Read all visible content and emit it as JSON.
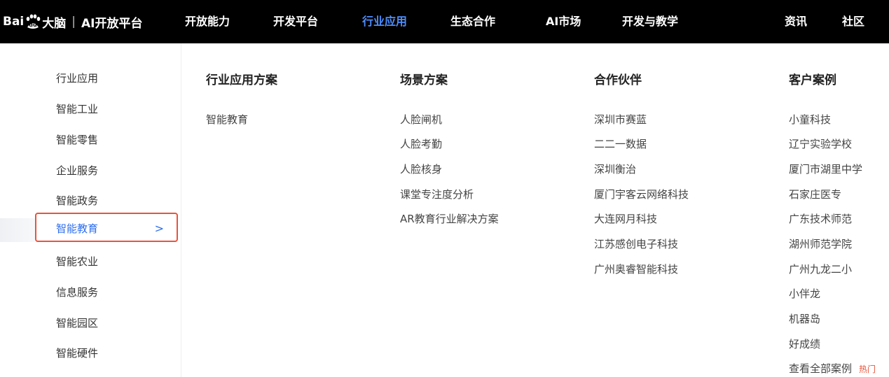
{
  "brand": {
    "logo_left": "Bai",
    "logo_paw": "du",
    "logo_cn": "大脑",
    "separator": "|",
    "platform": "AI开放平台"
  },
  "nav": {
    "items": [
      "开放能力",
      "开发平台",
      "行业应用",
      "生态合作",
      "AI市场",
      "开发与教学"
    ],
    "right_items": [
      "资讯",
      "社区"
    ],
    "active": "行业应用",
    "active_color": "#4c8dff"
  },
  "sidebar": {
    "items": [
      "行业应用",
      "智能工业",
      "智能零售",
      "企业服务",
      "智能政务",
      "智能教育",
      "智能农业",
      "信息服务",
      "智能园区",
      "智能硬件"
    ],
    "active": "智能教育",
    "chevron": ">",
    "highlight_border": "#e8543c"
  },
  "columns": {
    "solutions": {
      "title": "行业应用方案",
      "links": [
        "智能教育"
      ]
    },
    "scenarios": {
      "title": "场景方案",
      "links": [
        "人脸闸机",
        "人脸考勤",
        "人脸核身",
        "课堂专注度分析",
        "AR教育行业解决方案"
      ]
    },
    "partners": {
      "title": "合作伙伴",
      "links": [
        "深圳市赛蓝",
        "二二一数据",
        "深圳衡治",
        "厦门宇客云网络科技",
        "大连网月科技",
        "江苏感创电子科技",
        "广州奥睿智能科技"
      ]
    },
    "cases": {
      "title": "客户案例",
      "links": [
        "小童科技",
        "辽宁实验学校",
        "厦门市湖里中学",
        "石家庄医专",
        "广东技术师范",
        "湖州师范学院",
        "广州九龙二小",
        "小伴龙",
        "机器岛",
        "好成绩"
      ],
      "view_all": "查看全部案例",
      "hot": "热门"
    }
  }
}
